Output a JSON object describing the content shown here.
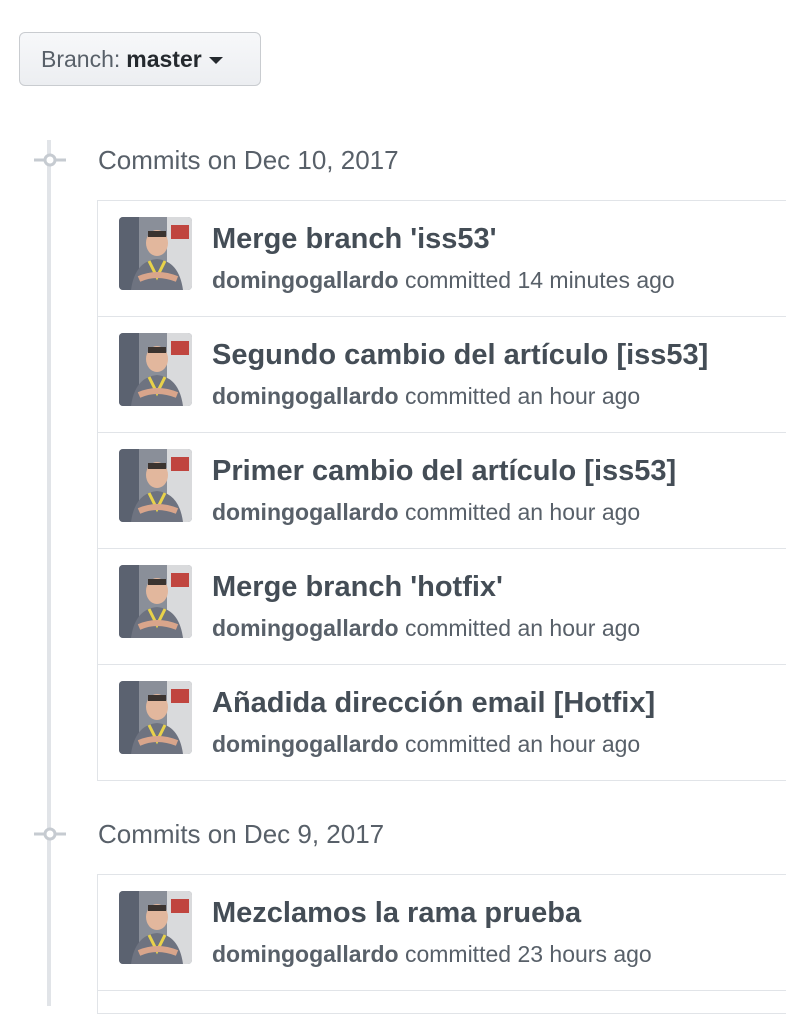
{
  "branch_selector": {
    "prefix": "Branch:",
    "name": "master",
    "icon": "caret-down-icon"
  },
  "commit_groups": [
    {
      "title": "Commits on Dec 10, 2017",
      "commits": [
        {
          "message": "Merge branch 'iss53'",
          "author": "domingogallardo",
          "verb": "committed",
          "time": "14 minutes ago"
        },
        {
          "message": "Segundo cambio del artículo [iss53]",
          "author": "domingogallardo",
          "verb": "committed",
          "time": "an hour ago"
        },
        {
          "message": "Primer cambio del artículo [iss53]",
          "author": "domingogallardo",
          "verb": "committed",
          "time": "an hour ago"
        },
        {
          "message": "Merge branch 'hotfix'",
          "author": "domingogallardo",
          "verb": "committed",
          "time": "an hour ago"
        },
        {
          "message": "Añadida dirección email [Hotfix]",
          "author": "domingogallardo",
          "verb": "committed",
          "time": "an hour ago"
        }
      ]
    },
    {
      "title": "Commits on Dec 9, 2017",
      "commits": [
        {
          "message": "Mezclamos la rama prueba",
          "author": "domingogallardo",
          "verb": "committed",
          "time": "23 hours ago"
        }
      ]
    }
  ],
  "colors": {
    "title": "#444d56",
    "meta": "#586069",
    "border": "#e1e4e8"
  }
}
